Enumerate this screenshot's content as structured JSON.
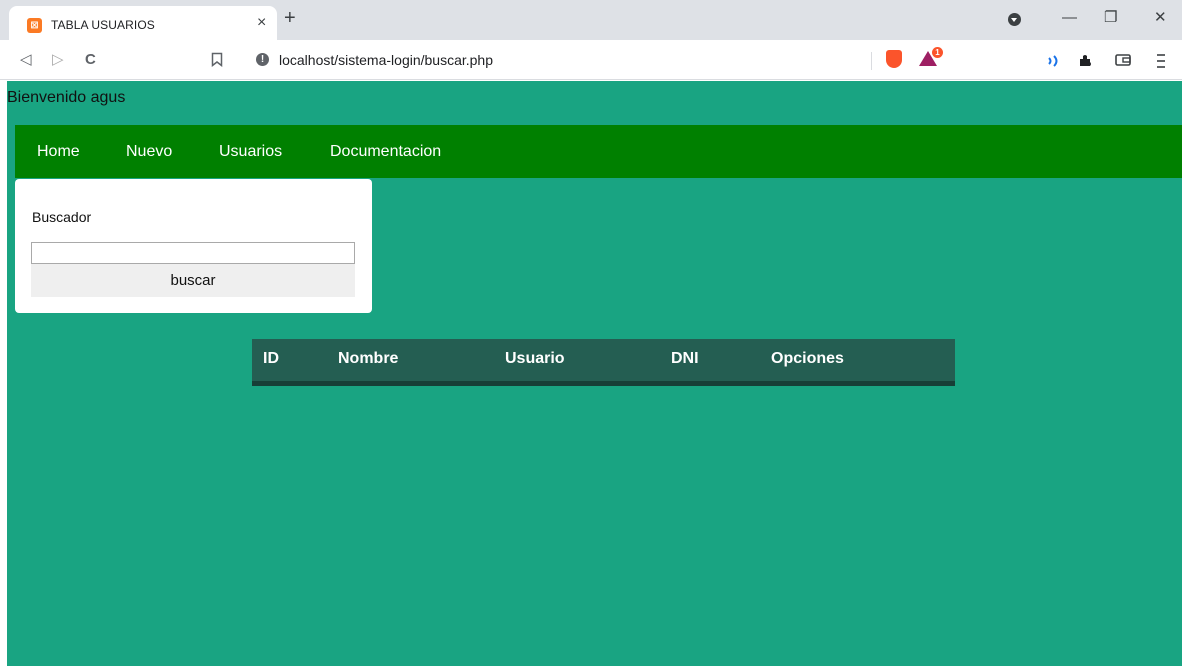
{
  "browser": {
    "tab_title": "TABLA USUARIOS",
    "tab_close": "×",
    "new_tab": "+",
    "url": "localhost/sistema-login/buscar.php",
    "rewards_badge": "1",
    "favicon_glyph": "⊠",
    "window_controls": [
      "—",
      "❐",
      "✕"
    ],
    "nav_buttons": [
      "◁",
      "▷",
      "C"
    ],
    "bookmark_icon": "bookmark-icon"
  },
  "page": {
    "welcome": "Bienvenido agus",
    "nav": [
      "Home",
      "Nuevo",
      "Usuarios",
      "Documentacion"
    ],
    "search": {
      "label": "Buscador",
      "value": "",
      "button": "buscar"
    },
    "table": {
      "headers": [
        "ID",
        "Nombre",
        "Usuario",
        "DNI",
        "Opciones"
      ],
      "rows": []
    }
  },
  "colors": {
    "page_bg": "#19a482",
    "navbar": "#008000",
    "table_header": "#245e52",
    "table_border": "#173f37"
  }
}
